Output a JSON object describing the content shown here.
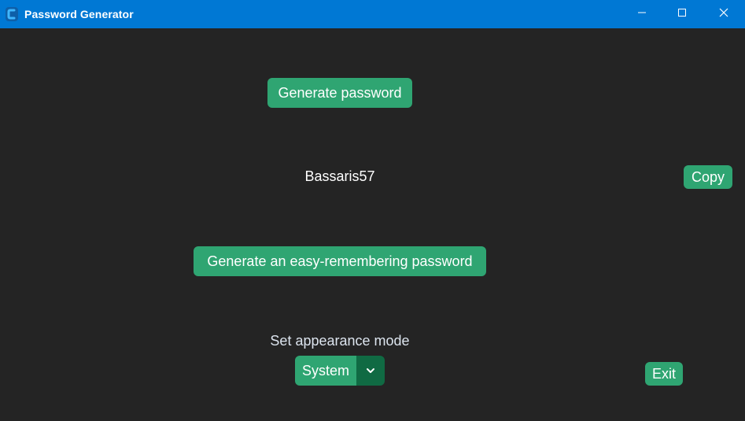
{
  "window": {
    "title": "Password Generator",
    "accent_color": "#0078d4",
    "icons": {
      "app": "app-icon",
      "minimize": "minimize-icon",
      "maximize": "maximize-icon",
      "close": "close-icon"
    }
  },
  "main": {
    "background_color": "#242424",
    "button_color": "#2fa572",
    "generate_button_label": "Generate password",
    "password_value": "Bassaris57",
    "copy_button_label": "Copy",
    "easy_button_label": "Generate an easy-remembering password",
    "appearance_label": "Set appearance mode",
    "appearance_selected": "System",
    "appearance_dropdown_icon": "chevron-down-icon",
    "exit_button_label": "Exit"
  }
}
